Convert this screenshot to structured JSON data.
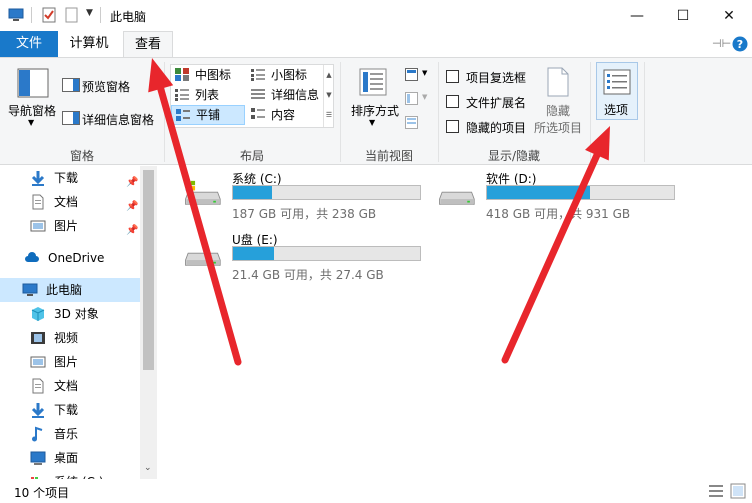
{
  "window": {
    "title": "此电脑",
    "controls": {
      "minimize": "—",
      "maximize": "☐",
      "close": "✕"
    }
  },
  "tabs": [
    {
      "label": "文件"
    },
    {
      "label": "计算机"
    },
    {
      "label": "查看"
    }
  ],
  "ribbon": {
    "pane_group": {
      "nav_pane": "导航窗格",
      "preview_pane": "预览窗格",
      "details_pane": "详细信息窗格",
      "label": "窗格"
    },
    "layout_group": {
      "items": [
        "中图标",
        "小图标",
        "列表",
        "详细信息",
        "平铺",
        "内容"
      ],
      "selected": "平铺",
      "label": "布局"
    },
    "view_group": {
      "sort_by": "排序方式",
      "label": "当前视图"
    },
    "showhide_group": {
      "item_checkboxes": "项目复选框",
      "file_extensions": "文件扩展名",
      "hidden_items": "隐藏的项目",
      "hide_selected_1": "隐藏",
      "hide_selected_2": "所选项目",
      "label": "显示/隐藏"
    },
    "options": {
      "label": "选项"
    }
  },
  "nav": {
    "items": [
      {
        "label": "下载",
        "icon": "download-icon",
        "pinned": true
      },
      {
        "label": "文档",
        "icon": "document-icon",
        "pinned": true
      },
      {
        "label": "图片",
        "icon": "pictures-icon",
        "pinned": true
      },
      {
        "label": "OneDrive",
        "icon": "cloud-icon"
      },
      {
        "label": "此电脑",
        "icon": "computer-icon",
        "selected": true
      },
      {
        "label": "3D 对象",
        "icon": "cube-icon"
      },
      {
        "label": "视频",
        "icon": "video-icon"
      },
      {
        "label": "图片",
        "icon": "pictures-icon"
      },
      {
        "label": "文档",
        "icon": "document-icon"
      },
      {
        "label": "下载",
        "icon": "download-icon"
      },
      {
        "label": "音乐",
        "icon": "music-icon"
      },
      {
        "label": "桌面",
        "icon": "desktop-icon"
      },
      {
        "label": "系统 (C:)",
        "icon": "drive-icon"
      }
    ]
  },
  "drives": [
    {
      "name": "系统 (C:)",
      "space": "187 GB 可用，共 238 GB",
      "used_fraction": 0.21
    },
    {
      "name": "软件 (D:)",
      "space": "418 GB 可用，共 931 GB",
      "used_fraction": 0.55
    },
    {
      "name": "U盘 (E:)",
      "space": "21.4 GB 可用，共 27.4 GB",
      "used_fraction": 0.22
    }
  ],
  "status": {
    "count": "10 个项目"
  },
  "colors": {
    "accent": "#1979ca",
    "bar": "#26a0da",
    "selection": "#cce8ff",
    "arrow": "#e8262c"
  }
}
